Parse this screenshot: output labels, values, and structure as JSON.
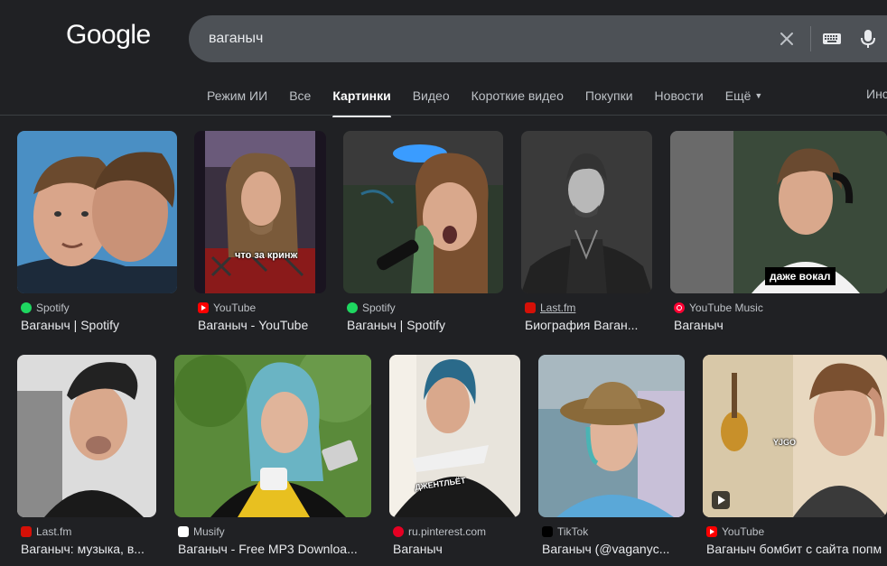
{
  "header": {
    "logo": "Google",
    "search_value": "ваганыч"
  },
  "tabs": [
    {
      "label": "Режим ИИ"
    },
    {
      "label": "Все"
    },
    {
      "label": "Картинки",
      "active": true
    },
    {
      "label": "Видео"
    },
    {
      "label": "Короткие видео"
    },
    {
      "label": "Покупки"
    },
    {
      "label": "Новости"
    },
    {
      "label": "Ещё"
    }
  ],
  "tools_label": "Инс",
  "results": [
    {
      "source": "Spotify",
      "title": "Ваганыч | Spotify",
      "favicon": "spotify"
    },
    {
      "source": "YouTube",
      "title": "Ваганыч - YouTube",
      "favicon": "youtube",
      "caption": "что за кринж"
    },
    {
      "source": "Spotify",
      "title": "Ваганыч | Spotify",
      "favicon": "spotify"
    },
    {
      "source": "Last.fm",
      "title": "Биография Ваган...",
      "favicon": "lastfm"
    },
    {
      "source": "YouTube Music",
      "title": "Ваганыч",
      "favicon": "ytmusic",
      "caption": "даже вокал"
    },
    {
      "source": "Last.fm",
      "title": "Ваганыч: музыка, в...",
      "favicon": "lastfm"
    },
    {
      "source": "Musify",
      "title": "Ваганыч - Free MP3 Downloa...",
      "favicon": "musify"
    },
    {
      "source": "ru.pinterest.com",
      "title": "Ваганыч",
      "favicon": "pinterest",
      "caption": "ДЖЕНТЛЬЁТ"
    },
    {
      "source": "TikTok",
      "title": "Ваганыч (@vaganyc...",
      "favicon": "tiktok"
    },
    {
      "source": "YouTube",
      "title": "Ваганыч бомбит с сайта попм",
      "favicon": "youtube",
      "caption": "YJGO"
    }
  ]
}
